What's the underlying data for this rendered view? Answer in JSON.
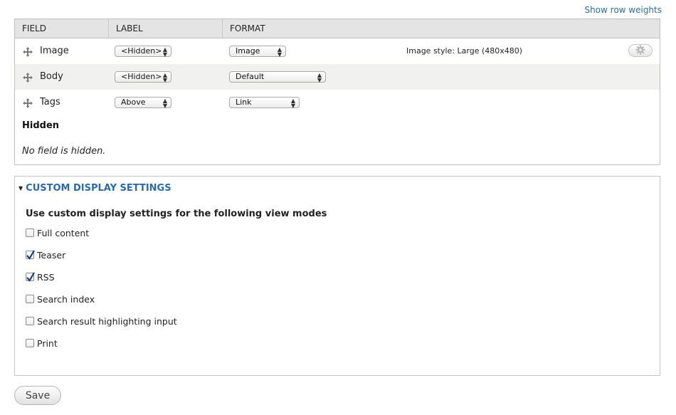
{
  "top_link": "Show row weights",
  "table": {
    "headers": {
      "field": "FIELD",
      "label": "LABEL",
      "format": "FORMAT"
    },
    "rows": [
      {
        "field": "Image",
        "label": "<Hidden>",
        "format": "Image",
        "summary": "Image style: Large (480x480)",
        "has_settings": true
      },
      {
        "field": "Body",
        "label": "<Hidden>",
        "format": "Default",
        "summary": "",
        "has_settings": false
      },
      {
        "field": "Tags",
        "label": "Above",
        "format": "Link",
        "summary": "",
        "has_settings": false
      }
    ],
    "hidden_title": "Hidden",
    "hidden_empty": "No field is hidden."
  },
  "custom_display": {
    "legend": "CUSTOM DISPLAY SETTINGS",
    "title": "Use custom display settings for the following view modes",
    "options": [
      {
        "label": "Full content",
        "checked": false
      },
      {
        "label": "Teaser",
        "checked": true
      },
      {
        "label": "RSS",
        "checked": true
      },
      {
        "label": "Search index",
        "checked": false
      },
      {
        "label": "Search result highlighting input",
        "checked": false
      },
      {
        "label": "Print",
        "checked": false
      }
    ]
  },
  "save_label": "Save",
  "colors": {
    "link": "#2a6aa6",
    "header_bg": "#e4e4e4",
    "alt_row": "#f1f1ef"
  }
}
